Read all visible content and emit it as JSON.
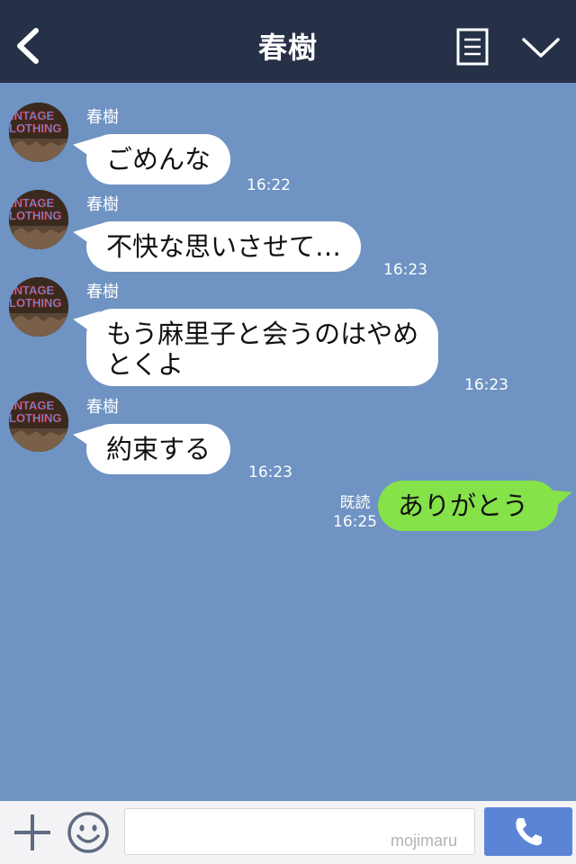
{
  "header": {
    "title": "春樹",
    "icons": [
      "chevron-left-icon",
      "notes-icon",
      "chevron-down-icon"
    ]
  },
  "avatar": {
    "text_line1": "INTAGE",
    "text_line2": "LOTHING"
  },
  "messages": [
    {
      "sender": "春樹",
      "text": "ごめんな",
      "time": "16:22",
      "direction": "in"
    },
    {
      "sender": "春樹",
      "text": "不快な思いさせて…",
      "time": "16:23",
      "direction": "in"
    },
    {
      "sender": "春樹",
      "text_line1": "もう麻里子と会うのはやめ",
      "text_line2": "とくよ",
      "time": "16:23",
      "direction": "in"
    },
    {
      "sender": "春樹",
      "text": "約束する",
      "time": "16:23",
      "direction": "in"
    },
    {
      "text": "ありがとう",
      "read": "既読",
      "time": "16:25",
      "direction": "out"
    }
  ],
  "footer": {
    "input_value": "",
    "watermark": "mojimaru",
    "icons": [
      "plus-icon",
      "emoji-icon",
      "phone-icon"
    ]
  },
  "colors": {
    "header_bg": "#263046",
    "chat_bg": "#6f93c2",
    "incoming_bubble": "#ffffff",
    "outgoing_bubble": "#85e249",
    "call_button": "#5b84d7"
  }
}
